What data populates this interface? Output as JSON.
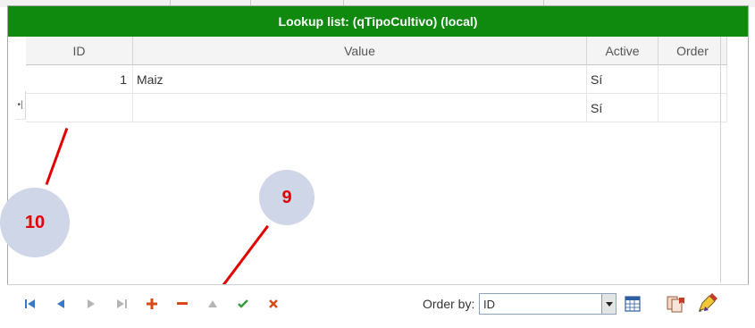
{
  "window": {
    "title": "Lookup list: (qTipoCultivo) (local)"
  },
  "grid": {
    "columns": [
      "ID",
      "Value",
      "Active",
      "Order"
    ],
    "rows": [
      {
        "id": "1",
        "value": "Maiz",
        "active": "Sí",
        "order": ""
      },
      {
        "id": "",
        "value": "",
        "active": "Sí",
        "order": ""
      }
    ],
    "new_row_marker": "•|"
  },
  "annotations": {
    "callout_9": "9",
    "callout_10": "10",
    "color": "#e00000"
  },
  "toolbar": {
    "order_by_label": "Order by:",
    "order_by_value": "ID",
    "icons": [
      "first-record-icon",
      "previous-record-icon",
      "next-record-icon",
      "last-record-icon",
      "add-record-icon",
      "delete-record-icon",
      "edit-record-icon",
      "save-record-icon",
      "cancel-record-icon",
      "calendar-grid-icon",
      "report-icon",
      "edit-tool-icon"
    ]
  },
  "colors": {
    "title_bar": "#0f8a0f",
    "nav_blue": "#3a78c8",
    "nav_gray": "#b5b5b5",
    "accent_red": "#d94a1a"
  }
}
